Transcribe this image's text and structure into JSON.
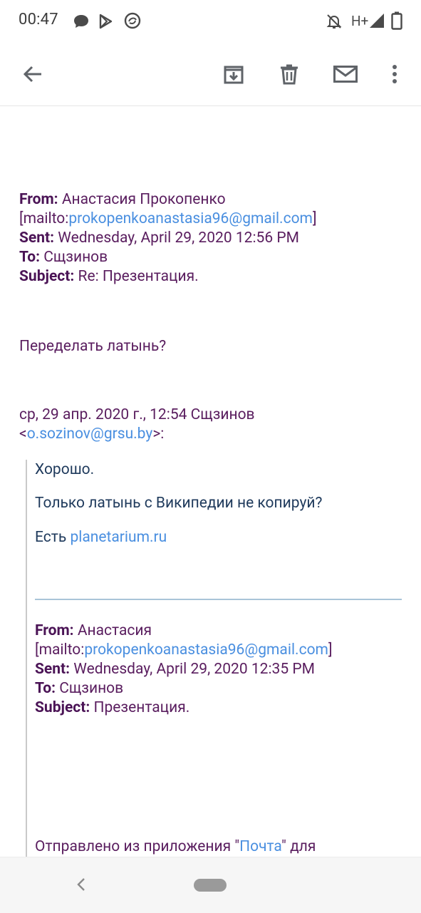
{
  "status": {
    "time": "00:47",
    "network": "H+"
  },
  "email": {
    "from_label": "From:",
    "from_value": "Анастасия Прокопенко",
    "mailto_prefix": "[mailto:",
    "mailto_addr": "prokopenkoanastasia96@gmail.com",
    "mailto_suffix": "]",
    "sent_label": "Sent:",
    "sent_value": "Wednesday, April 29, 2020 12:56 PM",
    "to_label": "To:",
    "to_value": "Сщзинов",
    "subject_label": "Subject:",
    "subject_value": "Re: Презентация.",
    "body": "Переделать латынь?",
    "reply_line1": "ср, 29 апр. 2020 г., 12:54 Сщзинов",
    "reply_lt": "<",
    "reply_email": "o.sozinov@grsu.by",
    "reply_gt": ">:"
  },
  "quoted": {
    "line1": "Хорошо.",
    "line2": "Только латынь с Википедии не копируй?",
    "line3_prefix": "Есть ",
    "line3_link": "planetarium.ru",
    "from_label": "From:",
    "from_value": "Анастасия",
    "mailto_prefix": "[mailto:",
    "mailto_addr": "prokopenkoanastasia96@gmail.com",
    "mailto_suffix": "]",
    "sent_label": "Sent:",
    "sent_value": "Wednesday, April 29, 2020 12:35 PM",
    "to_label": "To:",
    "to_value": "Сщзинов",
    "subject_label": "Subject:",
    "subject_value": "Презентация.",
    "footer_prefix": "Отправлено из приложения \"",
    "footer_link": "Почта",
    "footer_suffix": "\" для"
  }
}
